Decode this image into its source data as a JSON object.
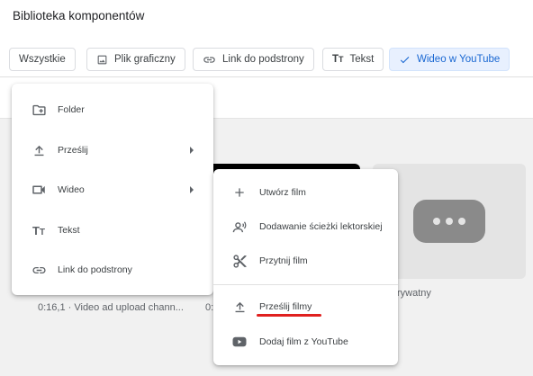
{
  "header": {
    "title": "Biblioteka komponentów"
  },
  "filters": [
    {
      "label": "Wszystkie",
      "icon": "none",
      "selected": false
    },
    {
      "label": "Plik graficzny",
      "icon": "image-icon",
      "selected": false
    },
    {
      "label": "Link do podstrony",
      "icon": "link-icon",
      "selected": false
    },
    {
      "label": "Tekst",
      "icon": "text-icon",
      "selected": false
    },
    {
      "label": "Wideo w YouTube",
      "icon": "check-icon",
      "selected": true
    }
  ],
  "cards": {
    "card1_caption_line2": "0:16,1 · Video ad upload chann...",
    "card2_caption_line2": "0:",
    "card3_caption_line1": "rywatny"
  },
  "main_menu": {
    "items": [
      {
        "label": "Folder",
        "icon": "folder-add-icon",
        "submenu": false
      },
      {
        "label": "Prześlij",
        "icon": "upload-icon",
        "submenu": true
      },
      {
        "label": "Wideo",
        "icon": "video-camera-icon",
        "submenu": true
      },
      {
        "label": "Tekst",
        "icon": "text-icon",
        "submenu": false
      },
      {
        "label": "Link do podstrony",
        "icon": "link-icon",
        "submenu": false
      }
    ]
  },
  "video_submenu": {
    "items": [
      {
        "label": "Utwórz film",
        "icon": "plus-icon"
      },
      {
        "label": "Dodawanie ścieżki lektorskiej",
        "icon": "voiceover-icon"
      },
      {
        "label": "Przytnij film",
        "icon": "scissors-icon"
      },
      {
        "label": "Prześlij filmy",
        "icon": "upload-icon",
        "highlighted": true
      },
      {
        "label": "Dodaj film z YouTube",
        "icon": "youtube-icon"
      }
    ]
  },
  "colors": {
    "accent": "#1967d2",
    "selected_chip_bg": "#e8f0fe",
    "highlight_underline": "#e0201f"
  }
}
